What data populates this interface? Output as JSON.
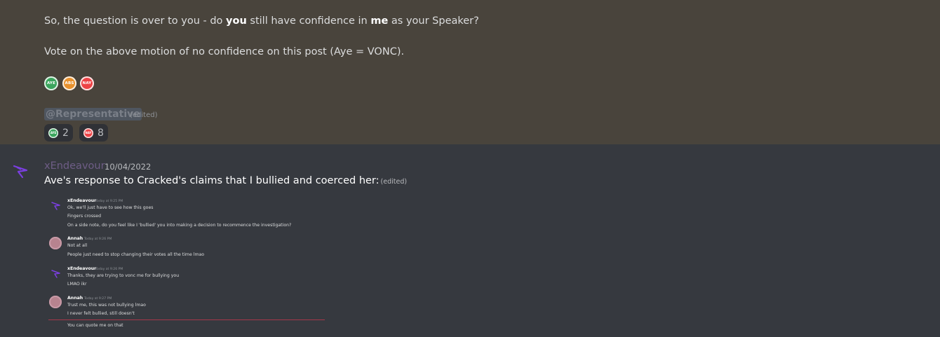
{
  "highlighted_message": {
    "line1_pre": "So, the question is over to you - do ",
    "line1_bold1": "you",
    "line1_mid": " still have confidence in ",
    "line1_bold2": "me",
    "line1_post": " as your Speaker?",
    "line2": "Vote on the above motion of no confidence on this post (Aye = VONC).",
    "emojis": [
      {
        "name": "aye-emoji",
        "label": "AYE",
        "color": "#3ba55d"
      },
      {
        "name": "abs-emoji",
        "label": "ABS",
        "color": "#e8912d"
      },
      {
        "name": "nay-emoji",
        "label": "NAY",
        "color": "#ed4245"
      }
    ],
    "mention": "@Representative",
    "edited": "(edited)",
    "reactions": [
      {
        "emoji": "AYE",
        "count": "2",
        "color": "#3ba55d"
      },
      {
        "emoji": "NAY",
        "count": "8",
        "color": "#ed4245"
      }
    ]
  },
  "message": {
    "author": "xEndeavour",
    "timestamp": "10/04/2022",
    "text": "Ave's response to Cracked's claims that I bullied and coerced her:",
    "edited": "(edited)"
  },
  "attachment": {
    "messages": [
      {
        "author": "xEndeavour",
        "time": "Today at 9:25 PM",
        "lines": [
          "Ok, we'll just have to see how this goes",
          "Fingers crossed",
          "On a side note, do you feel like I 'bullied' you into making a decision to recommence the investigation?"
        ]
      },
      {
        "author": "Annah",
        "time": "Today at 9:26 PM",
        "lines": [
          "Not at all",
          "People just need to stop changing their votes all the time lmao"
        ]
      },
      {
        "author": "xEndeavour",
        "time": "Today at 9:26 PM",
        "lines": [
          "Thanks, they are trying to vonc me for bullying you",
          "LMAO ikr"
        ]
      },
      {
        "author": "Annah",
        "time": "Today at 9:27 PM",
        "lines": [
          "Trust me, this was not bullying lmao",
          "I never felt bullied, still doesn't"
        ]
      }
    ],
    "after_divider": "You can quote me on that"
  },
  "colors": {
    "highlight_bg": "#49443c",
    "channel_bg": "#36393f",
    "author_name": "#6e5d86",
    "robot_icon": "#7b3fe0"
  }
}
